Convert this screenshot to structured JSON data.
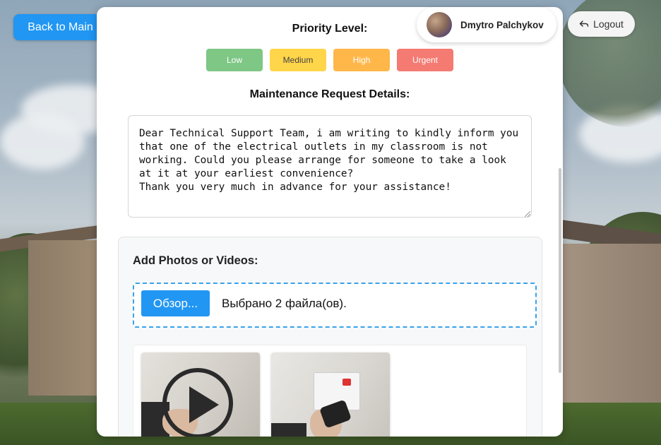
{
  "nav": {
    "back_label": "Back to Main"
  },
  "user": {
    "name": "Dmytro Palchykov",
    "logout_label": "Logout"
  },
  "form": {
    "priority_title": "Priority Level:",
    "priorities": [
      {
        "label": "Low",
        "color": "#7ec785"
      },
      {
        "label": "Medium",
        "color": "#ffd54a"
      },
      {
        "label": "High",
        "color": "#ffb74a"
      },
      {
        "label": "Urgent",
        "color": "#f47a72"
      }
    ],
    "details_title": "Maintenance Request Details:",
    "details_text": "Dear Technical Support Team, i am writing to kindly inform you that one of the electrical outlets in my classroom is not working. Could you please arrange for someone to take a look at it at your earliest convenience?\nThank you very much in advance for your assistance!",
    "upload": {
      "title": "Add Photos or Videos:",
      "browse_label": "Обзор...",
      "selected_text": "Выбрано 2 файла(ов)."
    },
    "previews": [
      {
        "kind": "video",
        "icon": "play-icon"
      },
      {
        "kind": "image"
      }
    ]
  },
  "colors": {
    "accent": "#2196f3"
  }
}
